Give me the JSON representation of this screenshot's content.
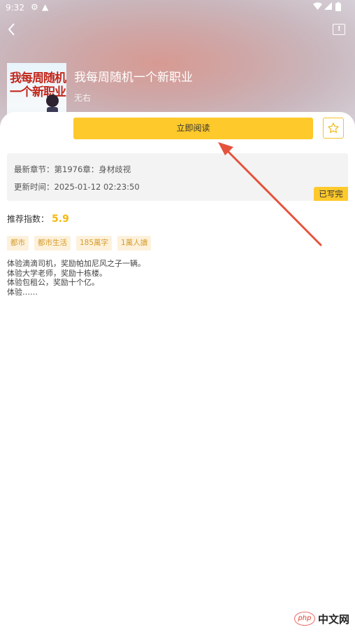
{
  "status_bar": {
    "time": "9:32"
  },
  "book": {
    "title": "我每周随机一个新职业",
    "author": "无右",
    "cover_text": "我每周随机一个新职业",
    "gender_symbol": "♂"
  },
  "actions": {
    "read_label": "立即阅读"
  },
  "info": {
    "latest_chapter_label": "最新章节：",
    "latest_chapter": "第1976章：身材歧视",
    "update_time_label": "更新时间：",
    "update_time": "2025-01-12 02:23:50",
    "status_tag": "已写完"
  },
  "recommend": {
    "label": "推荐指数：",
    "score": "5.9"
  },
  "tags": [
    "都市",
    "都市生活",
    "185萬字",
    "1萬人讀"
  ],
  "description": [
    "体验滴滴司机，奖励帕加尼风之子一辆。",
    "体验大学老师，奖励十栋楼。",
    "体验包租公，奖励十个亿。",
    "体验……"
  ],
  "watermark": {
    "logo": "php",
    "text": "中文网"
  },
  "colors": {
    "accent": "#fec92b",
    "tag_bg": "#fdf1dc",
    "tag_text": "#d59a28",
    "arrow": "#e5533d"
  }
}
